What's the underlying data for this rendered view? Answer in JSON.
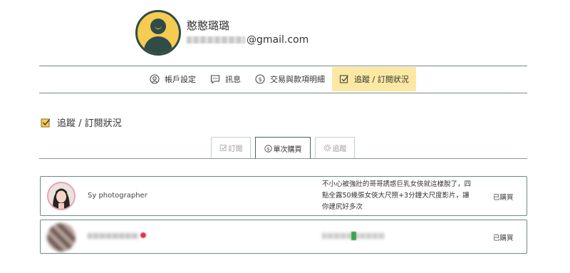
{
  "profile": {
    "name": "憨憨璐璐",
    "email_domain": "@gmail.com"
  },
  "nav": {
    "items": [
      {
        "label": "帳戶設定",
        "icon": "user-settings-icon"
      },
      {
        "label": "訊息",
        "icon": "chat-icon"
      },
      {
        "label": "交易與款項明細",
        "icon": "dollar-coin-icon"
      },
      {
        "label": "追蹤 / 訂閱狀況",
        "icon": "checkbox-icon",
        "active": true
      }
    ]
  },
  "section": {
    "title": "追蹤 / 訂閱狀況"
  },
  "tabs": [
    {
      "label": "訂閱",
      "icon": "checkbox-icon"
    },
    {
      "label": "單次購買",
      "icon": "dollar-coin-icon",
      "active": true
    },
    {
      "label": "追蹤",
      "icon": "gear-icon"
    }
  ],
  "purchases": [
    {
      "name": "Sy photographer",
      "description": "不小心被強壯的哥哥誘惑巨乳女俠就這樣脫了，四點全露50幾張女俠大尺照+3分鐘大尺度影片，讓你建尻好多次",
      "status": "已購買"
    },
    {
      "name": "",
      "description": "",
      "status": "已購買"
    }
  ],
  "colors": {
    "accent_yellow": "#fbe9a3",
    "dark_green": "#2f4c46",
    "border_green": "#6f8a84"
  }
}
